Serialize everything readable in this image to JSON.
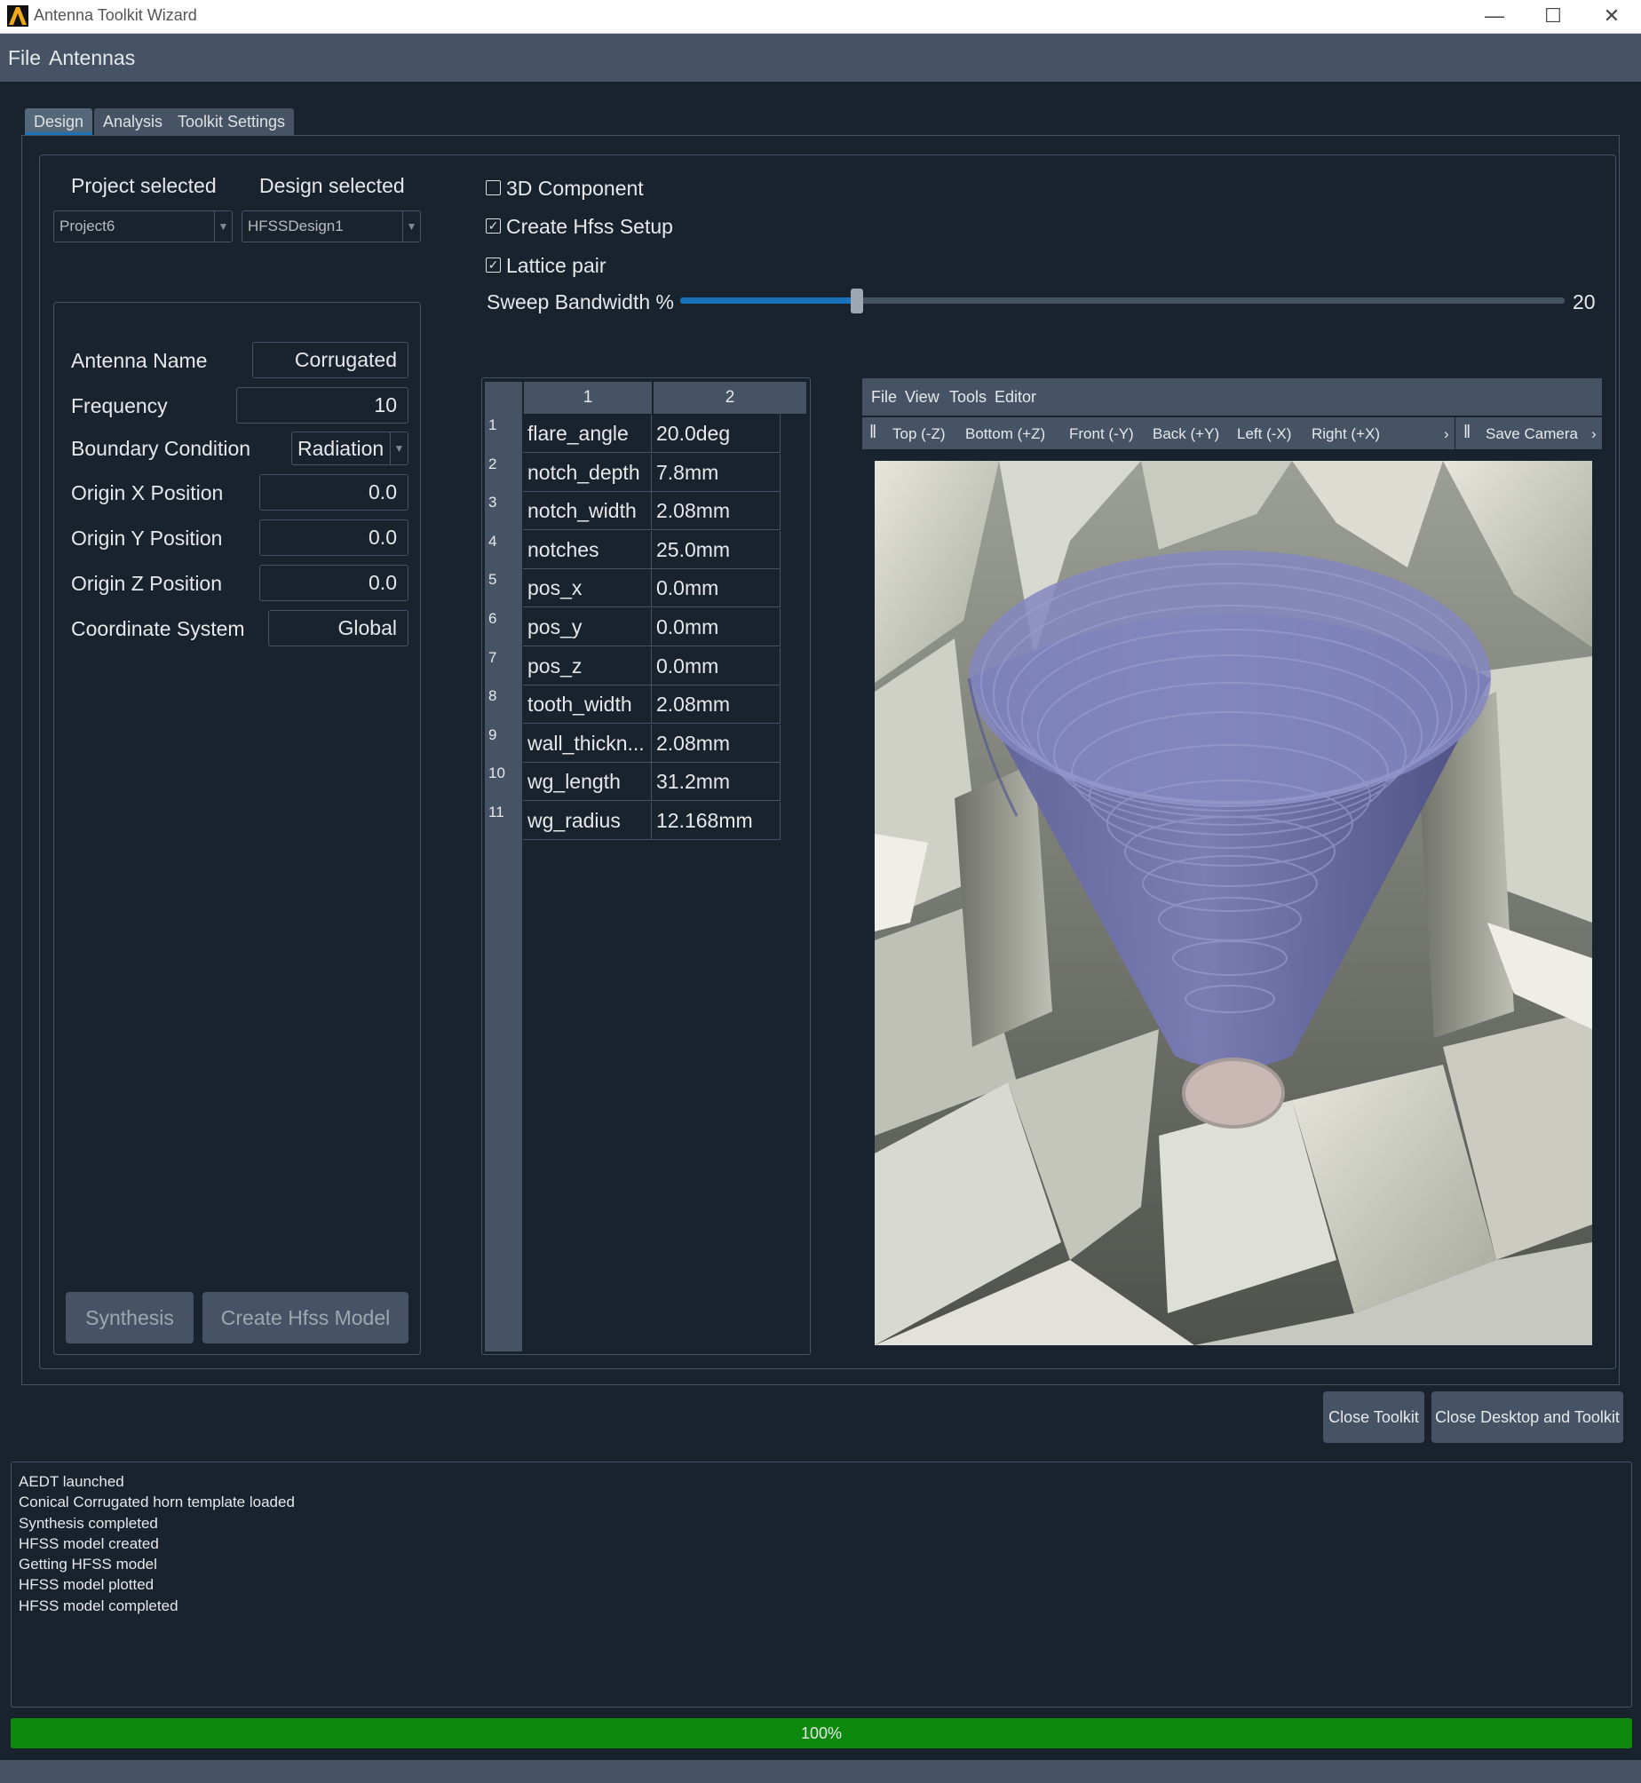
{
  "window": {
    "title": "Antenna Toolkit Wizard",
    "controls": [
      "—",
      "☐",
      "✕"
    ]
  },
  "menubar": {
    "items": [
      "File",
      "Antennas"
    ]
  },
  "tabs": [
    {
      "label": "Design",
      "active": true
    },
    {
      "label": "Analysis",
      "active": false
    },
    {
      "label": "Toolkit Settings",
      "active": false
    }
  ],
  "project": {
    "project_label": "Project selected",
    "design_label": "Design selected",
    "project_value": "Project6",
    "design_value": "HFSSDesign1"
  },
  "params": {
    "antenna_name": {
      "label": "Antenna Name",
      "value": "Corrugated"
    },
    "frequency": {
      "label": "Frequency",
      "value": "10"
    },
    "boundary": {
      "label": "Boundary Condition",
      "value": "Radiation"
    },
    "origin_x": {
      "label": "Origin X Position",
      "value": "0.0"
    },
    "origin_y": {
      "label": "Origin Y Position",
      "value": "0.0"
    },
    "origin_z": {
      "label": "Origin Z Position",
      "value": "0.0"
    },
    "coord_sys": {
      "label": "Coordinate System",
      "value": "Global"
    }
  },
  "actions": {
    "synthesis": "Synthesis",
    "create_model": "Create Hfss Model"
  },
  "options": {
    "component_3d": {
      "label": "3D Component",
      "checked": false
    },
    "create_setup": {
      "label": "Create Hfss Setup",
      "checked": true
    },
    "lattice_pair": {
      "label": "Lattice pair",
      "checked": true
    }
  },
  "sweep": {
    "label": "Sweep Bandwidth %",
    "value": "20",
    "fraction": 0.2
  },
  "table": {
    "headers": [
      "1",
      "2"
    ],
    "rows": [
      {
        "n": "1",
        "name": "flare_angle",
        "value": "20.0deg"
      },
      {
        "n": "2",
        "name": "notch_depth",
        "value": "7.8mm"
      },
      {
        "n": "3",
        "name": "notch_width",
        "value": "2.08mm"
      },
      {
        "n": "4",
        "name": "notches",
        "value": "25.0mm"
      },
      {
        "n": "5",
        "name": "pos_x",
        "value": "0.0mm"
      },
      {
        "n": "6",
        "name": "pos_y",
        "value": "0.0mm"
      },
      {
        "n": "7",
        "name": "pos_z",
        "value": "0.0mm"
      },
      {
        "n": "8",
        "name": "tooth_width",
        "value": "2.08mm"
      },
      {
        "n": "9",
        "name": "wall_thickn...",
        "value": "2.08mm"
      },
      {
        "n": "10",
        "name": "wg_length",
        "value": "31.2mm"
      },
      {
        "n": "11",
        "name": "wg_radius",
        "value": "12.168mm"
      }
    ]
  },
  "viewer": {
    "menu": [
      "File",
      "View",
      "Tools",
      "Editor"
    ],
    "camera": [
      "Top (-Z)",
      "Bottom (+Z)",
      "Front (-Y)",
      "Back (+Y)",
      "Left (-X)",
      "Right (+X)"
    ],
    "save_camera": "Save Camera"
  },
  "footer": {
    "close_toolkit": "Close Toolkit",
    "close_all": "Close Desktop and Toolkit"
  },
  "log": [
    "AEDT launched",
    "Conical Corrugated horn template loaded",
    "Synthesis completed",
    "HFSS model created",
    "Getting HFSS model",
    "HFSS model plotted",
    "HFSS model completed"
  ],
  "progress": {
    "label": "100%",
    "value": 1.0
  },
  "colors": {
    "background": "#19232d",
    "panel": "#455364",
    "accent": "#1a72bb",
    "progress": "#0d8a0d",
    "horn": "#7b7eb8"
  }
}
